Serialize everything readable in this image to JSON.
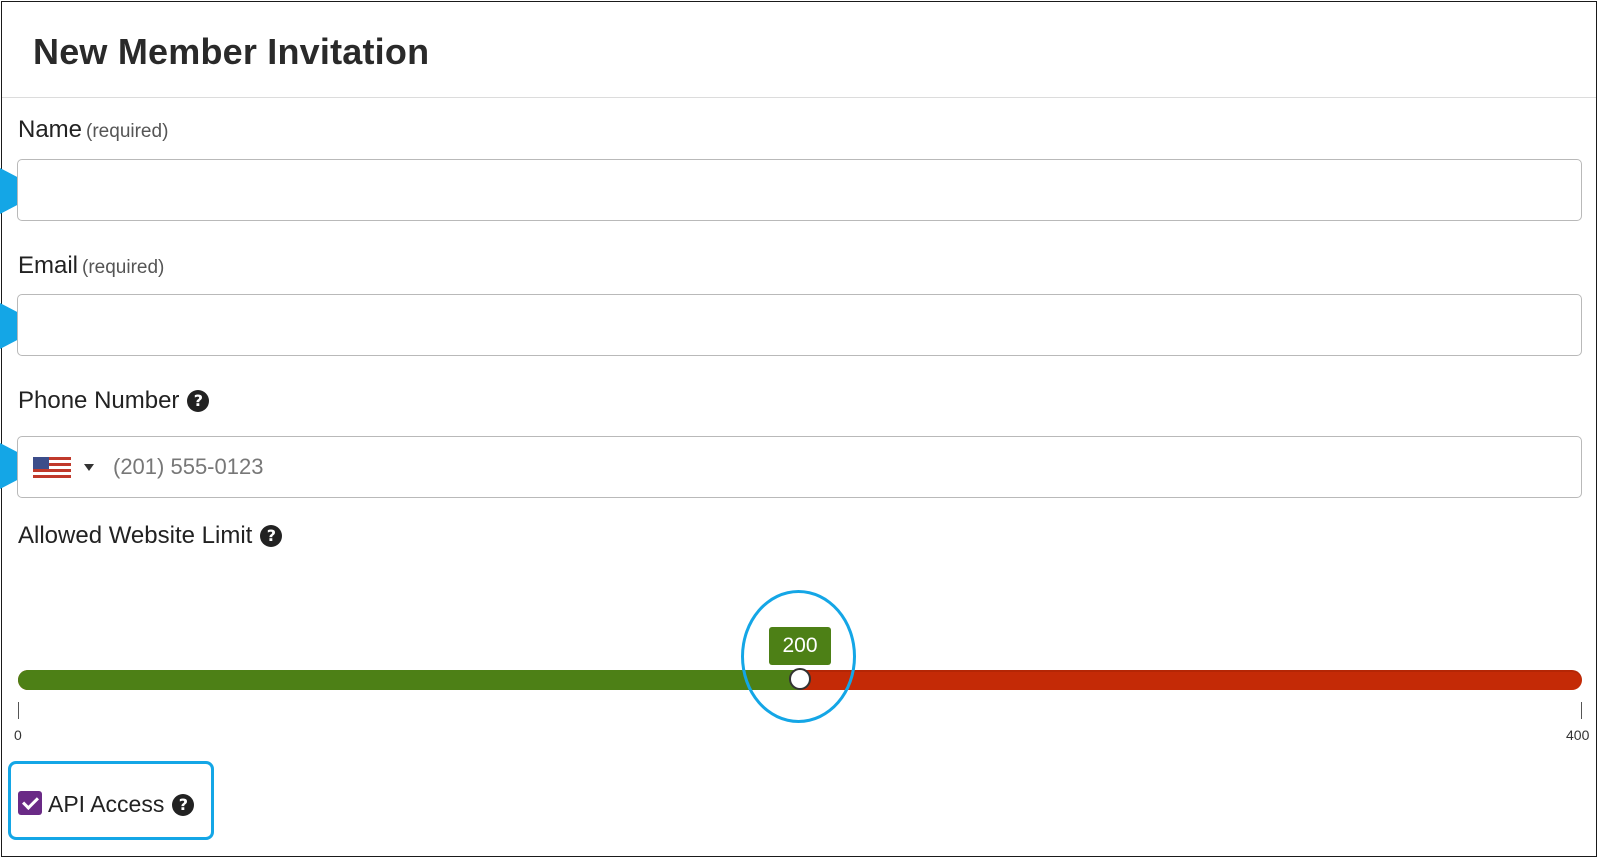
{
  "header": {
    "title": "New Member Invitation"
  },
  "form": {
    "name": {
      "label": "Name",
      "required_note": "(required)",
      "value": "",
      "placeholder": ""
    },
    "email": {
      "label": "Email",
      "required_note": "(required)",
      "value": "",
      "placeholder": ""
    },
    "phone": {
      "label": "Phone Number",
      "country_flag": "us-flag-icon",
      "placeholder": "(201) 555-0123",
      "value": ""
    },
    "website_limit": {
      "label": "Allowed Website Limit",
      "value": "200",
      "min": "0",
      "max": "400",
      "fill_color": "#4d8016",
      "remaining_color": "#c42a06"
    },
    "api_access": {
      "label": "API Access",
      "checked": true,
      "color": "#6a2a86"
    }
  },
  "icons": {
    "help": "?"
  },
  "annotations": {
    "pointer_color": "#14a6e6"
  }
}
